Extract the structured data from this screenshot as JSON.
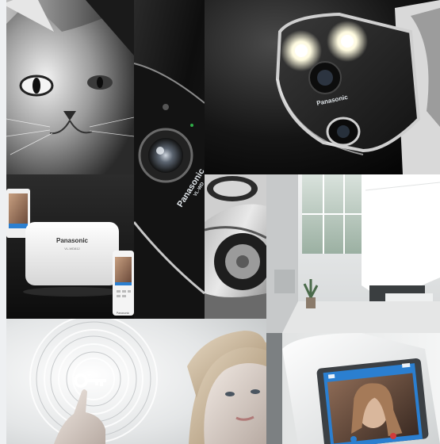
{
  "collage": {
    "tiles": [
      {
        "name": "cat-portrait",
        "subject": "black-and-white close-up of a cat face"
      },
      {
        "name": "door-camera-closeup",
        "subject": "dark video intercom door station camera lens"
      },
      {
        "name": "outdoor-security-camera",
        "subject": "wall-mounted security camera with two LED lights"
      },
      {
        "name": "wireless-hub-and-monitors",
        "subject": "white wireless hub with monitor and handset"
      },
      {
        "name": "car-detail",
        "subject": "close-up of a car wheel arch and mirror"
      },
      {
        "name": "modern-hallway",
        "subject": "bright white modern interior hallway"
      },
      {
        "name": "key-touch-woman",
        "subject": "finger touching key icon with woman portrait"
      },
      {
        "name": "indoor-monitor-screen",
        "subject": "wall-mounted monitor showing a visitor on screen"
      }
    ]
  },
  "brand": {
    "door_station_logo": "Panasonic",
    "door_station_model": "VL-WD",
    "camera_logo": "Panasonic",
    "hub_logo": "Panasonic",
    "hub_model": "VL-WD812",
    "monitor_logo": "Panasonic"
  },
  "colors": {
    "background": "#eef0f2",
    "accent": "#2b7fd0"
  }
}
